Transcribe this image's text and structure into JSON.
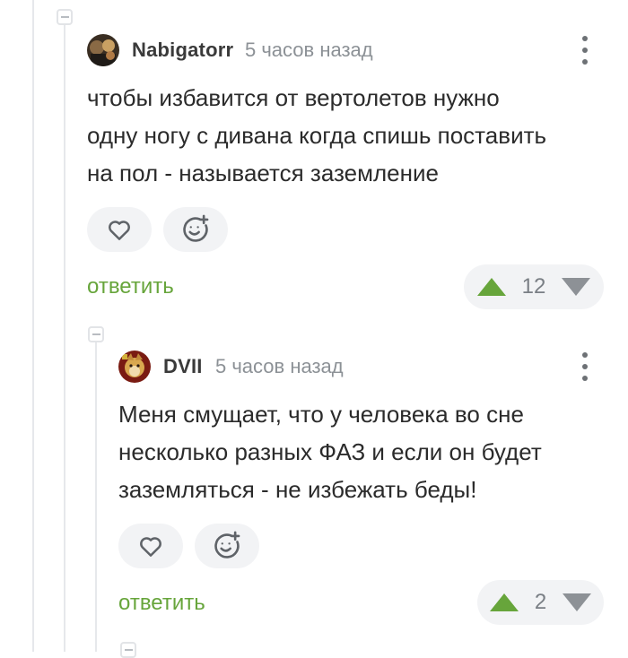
{
  "comments": [
    {
      "author": "Nabigatorr",
      "time": "5 часов назад",
      "text_lines": [
        "чтобы избавится от вертолетов нужно",
        "одну ногу с дивана когда спишь поставить",
        "на пол - называется заземление"
      ],
      "reply_label": "ответить",
      "rating": "12"
    },
    {
      "author": "DVII",
      "time": "5 часов назад",
      "text_lines": [
        "Меня смущает, что у человека во сне",
        "несколько разных ФАЗ и если он будет",
        "заземляться - не избежать беды!"
      ],
      "reply_label": "ответить",
      "rating": "2"
    }
  ],
  "colors": {
    "accent_green": "#67a53b",
    "vote_down_gray": "#8d9196",
    "icon_gray": "#5f6368"
  },
  "icons": {
    "like": "heart-icon",
    "react": "emoji-add-icon",
    "upvote": "triangle-up-icon",
    "downvote": "triangle-down-icon",
    "menu": "kebab-menu-icon",
    "collapse": "collapse-icon"
  }
}
